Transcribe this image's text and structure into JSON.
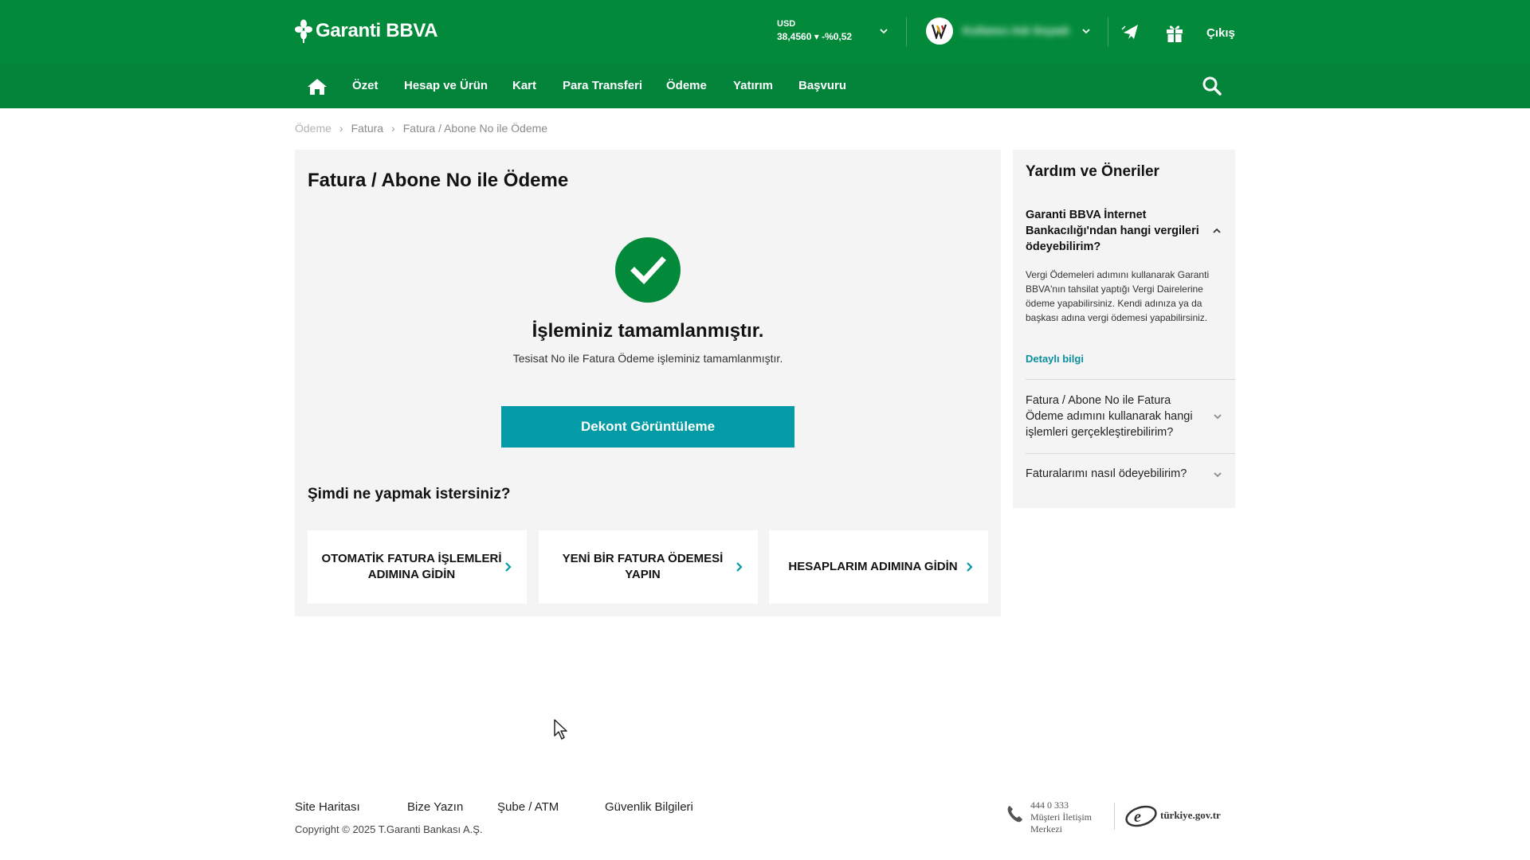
{
  "header": {
    "logo_text": "Garanti BBVA",
    "currency_label": "USD",
    "currency_value": "38,4560 ▾ -%0,52",
    "user_name": "Kullanıcı Adı Soyadı",
    "logout_label": "Çıkış",
    "brand_green": "#028a3a"
  },
  "nav": {
    "items": [
      "Özet",
      "Hesap ve Ürün",
      "Kart",
      "Para Transferi",
      "Ödeme",
      "Yatırım",
      "Başvuru"
    ]
  },
  "breadcrumb": [
    "Ödeme",
    "Fatura",
    "Fatura / Abone No ile Ödeme"
  ],
  "main": {
    "title": "Fatura / Abone No ile Ödeme",
    "success_title": "İşleminiz tamamlanmıştır.",
    "success_subtitle": "Tesisat No ile Fatura Ödeme işleminiz tamamlanmıştır.",
    "receipt_button": "Dekont Görüntüleme",
    "next_title": "Şimdi ne yapmak istersiniz?",
    "actions": [
      "OTOMATİK FATURA İŞLEMLERİ ADIMINA GİDİN",
      "YENİ BİR FATURA ÖDEMESİ YAPIN",
      "HESAPLARIM ADIMINA GİDİN"
    ],
    "accent_teal": "#029ba6"
  },
  "help": {
    "title": "Yardım ve Öneriler",
    "faq1_question": "Garanti BBVA İnternet Bankacılığı'ndan hangi vergileri ödeyebilirim?",
    "faq1_answer": "Vergi Ödemeleri adımını kullanarak Garanti BBVA'nın tahsilat yaptığı Vergi Dairelerine ödeme yapabilirsiniz. Kendi adınıza ya da başkası adına vergi ödemesi yapabilirsiniz.",
    "faq1_link": "Detaylı bilgi",
    "faq2_question": "Fatura / Abone No ile Fatura Ödeme adımını kullanarak hangi işlemleri gerçekleştirebilirim?",
    "faq3_question": "Faturalarımı nasıl ödeyebilirim?"
  },
  "footer": {
    "links": [
      "Site Haritası",
      "Bize Yazın",
      "Şube / ATM",
      "Güvenlik Bilgileri"
    ],
    "copyright": "Copyright © 2025 T.Garanti Bankası A.Ş.",
    "phone_number": "444 0 333",
    "phone_label_1": "Müşteri İletişim",
    "phone_label_2": "Merkezi",
    "egov_text": "türkiye.gov.tr"
  }
}
